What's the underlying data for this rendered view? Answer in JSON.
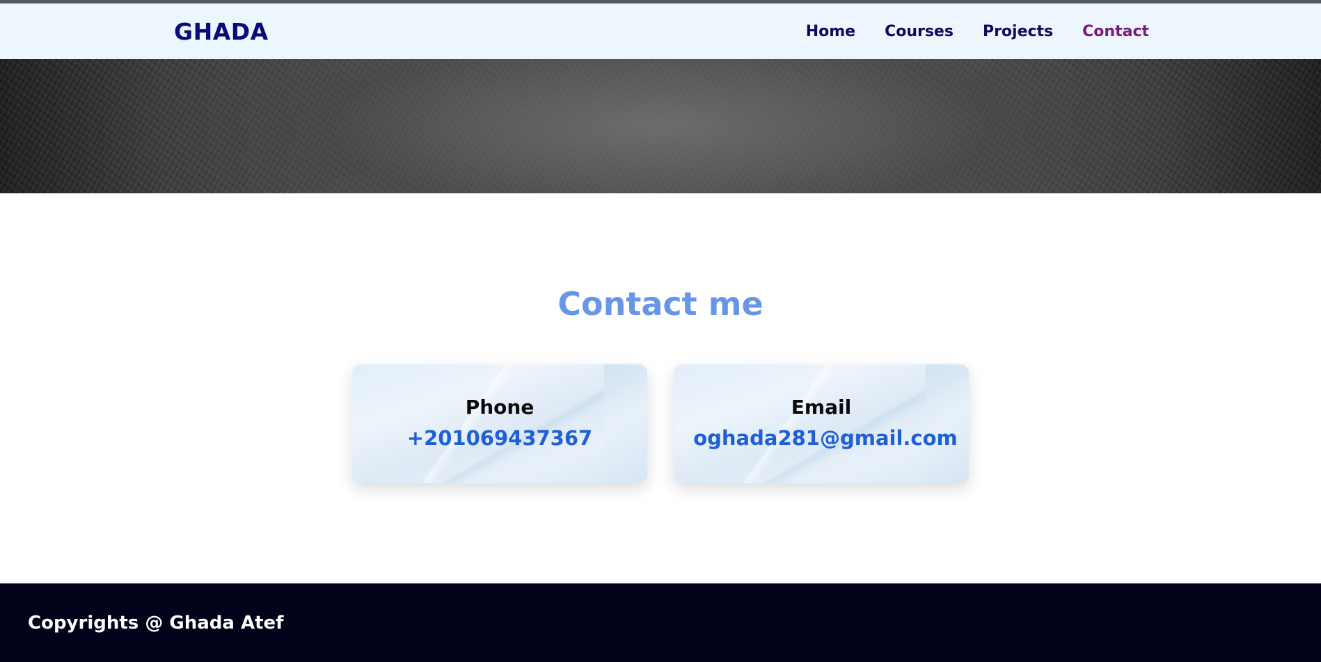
{
  "header": {
    "logo": "GHADA",
    "nav": [
      {
        "label": "Home"
      },
      {
        "label": "Courses"
      },
      {
        "label": "Projects"
      },
      {
        "label": "Contact"
      }
    ],
    "active_index": 3
  },
  "contact": {
    "title": "Contact me",
    "phone": {
      "label": "Phone",
      "value": "+201069437367"
    },
    "email": {
      "label": "Email",
      "value": "oghada281@gmail.com"
    }
  },
  "footer": {
    "text": "Copyrights @ Ghada Atef"
  },
  "colors": {
    "logo": "#0a0a7a",
    "nav_link": "#0b0b5e",
    "nav_active": "#7a1a7a",
    "title": "#6796e6",
    "contact_value": "#1f5fd6",
    "footer_bg": "#02021a"
  }
}
